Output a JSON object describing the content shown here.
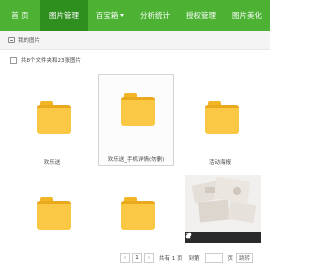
{
  "nav": {
    "items": [
      {
        "label": "首 页"
      },
      {
        "label": "图片管理"
      },
      {
        "label": "百宝箱"
      },
      {
        "label": "分析统计"
      },
      {
        "label": "授权管理"
      },
      {
        "label": "图片美化"
      }
    ],
    "active_index": 1,
    "colors": {
      "bar": "#4db234",
      "active": "#2f8f1e"
    }
  },
  "breadcrumb": {
    "text": "我的图片"
  },
  "selection": {
    "summary": "共8个文件夹和23张图片"
  },
  "items": [
    {
      "type": "folder",
      "label": "欢乐送"
    },
    {
      "type": "folder",
      "label": "欢乐送_手机详情(勿删)"
    },
    {
      "type": "folder",
      "label": "活动海报"
    },
    {
      "type": "folder",
      "label": ""
    },
    {
      "type": "folder",
      "label": ""
    },
    {
      "type": "image",
      "label": ""
    }
  ],
  "pager": {
    "prev": "‹",
    "page": "1",
    "next": "›",
    "total": "共有 1 页",
    "goto_prefix": "到第",
    "goto_suffix": "页",
    "goto_button": "跳转"
  }
}
